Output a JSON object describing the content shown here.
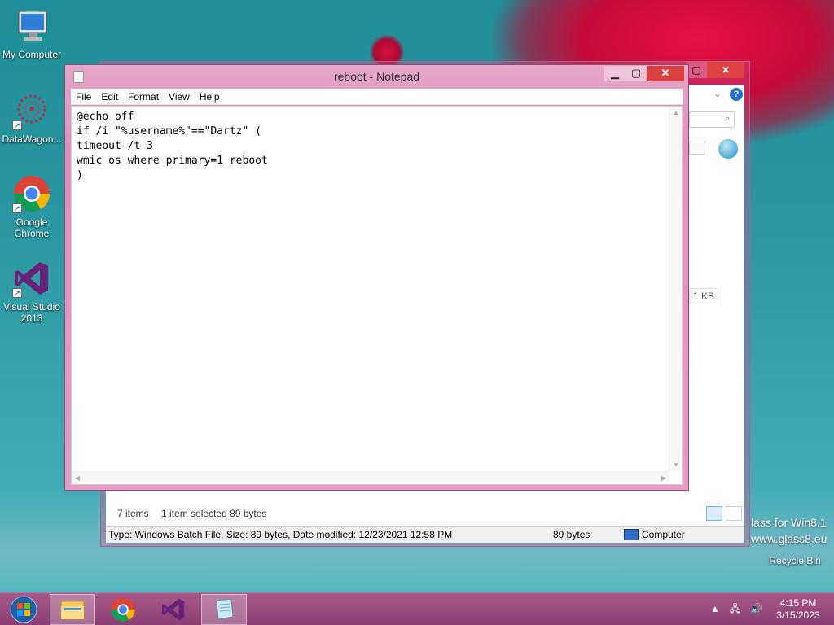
{
  "desktop": {
    "icons": [
      {
        "label": "My Computer",
        "icon": "computer-icon"
      },
      {
        "label": "DataWagon...",
        "icon": "datawagon-icon"
      },
      {
        "label": "Google Chrome",
        "icon": "chrome-icon"
      },
      {
        "label": "Visual Studio 2013",
        "icon": "visual-studio-icon"
      }
    ],
    "recycle_bin_label": "Recycle Bin",
    "watermark_line1": "lass for Win8.1",
    "watermark_line2": "www.glass8.eu"
  },
  "explorer": {
    "size_cell": "1 KB",
    "status_items": "7 items",
    "status_selected": "1 item selected  89 bytes",
    "details_type": "Type: Windows Batch File, Size: 89 bytes, Date modified: 12/23/2021 12:58 PM",
    "details_size": "89 bytes",
    "details_location": "Computer"
  },
  "notepad": {
    "title": "reboot - Notepad",
    "menu": [
      "File",
      "Edit",
      "Format",
      "View",
      "Help"
    ],
    "content": "@echo off\nif /i \"%username%\"==\"Dartz\" (\ntimeout /t 3\nwmic os where primary=1 reboot\n)",
    "minimize_label": "▁",
    "maximize_label": "▢",
    "close_label": "✕"
  },
  "taskbar": {
    "apps": [
      {
        "name": "file-explorer",
        "icon": "folder-icon",
        "active": true
      },
      {
        "name": "chrome",
        "icon": "chrome-icon",
        "active": false
      },
      {
        "name": "visual-studio",
        "icon": "visual-studio-icon",
        "active": false
      },
      {
        "name": "notepad",
        "icon": "notepad-icon",
        "active": true
      }
    ],
    "time": "4:15 PM",
    "date": "3/15/2023"
  },
  "colors": {
    "accent": "#d94141",
    "chrome_red": "#db4437",
    "chrome_green": "#0f9d58",
    "chrome_yellow": "#f4b400",
    "chrome_blue": "#4285f4",
    "vs_purple": "#68217a"
  }
}
